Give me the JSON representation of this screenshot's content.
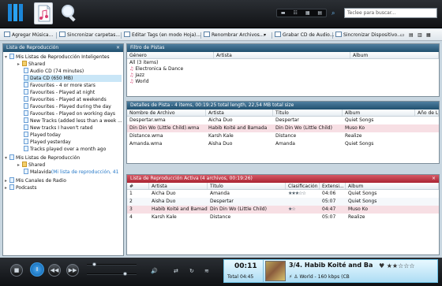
{
  "search": {
    "placeholder": "Teclee para buscar..."
  },
  "toolbar": {
    "items": [
      "Agregar Música...",
      "Sincronizar carpetas...",
      "Editar Tags (en modo Hoja)...",
      "Renombrar Archivos...",
      "Grabar CD de Audio...",
      "Sincronizar Dispositivo..."
    ]
  },
  "left_panel": {
    "title": "Lista de Reproducción",
    "items": [
      "Mis Listas de Reproducción Inteligentes",
      "Shared",
      "Audio CD (74 minutes)",
      "Data CD (650 MB)",
      "Favourites - 4 or more stars",
      "Favourites - Played at night",
      "Favourites - Played at weekends",
      "Favourites - Played during the day",
      "Favourites - Played on working days",
      "New Tracks (added less than a week ...",
      "New tracks I haven't rated",
      "Played today",
      "Played yesterday",
      "Tracks played over a month ago",
      "Mis Listas de Reproducción",
      "Shared",
      "Malavida",
      "(Mi lista de reproducción, 41",
      "Mis Canales de Radio",
      "Podcasts"
    ]
  },
  "filter": {
    "title": "Filtro de Pistas",
    "headers": [
      "Género",
      "Artista",
      "Album"
    ],
    "rows": [
      "All (3 items)",
      "Electronica & Dance",
      "Jazz",
      "World"
    ]
  },
  "details": {
    "title": "Detalles de Pista - 4 items, 00:19:25 total length, 22,54 MB total size",
    "headers": [
      "Nombre de Archivo",
      "Artista",
      "Título",
      "Album",
      "Año de La"
    ],
    "rows": [
      [
        "Despertar.wma",
        "Aicha Duo",
        "Despertar",
        "Quiet Songs",
        ""
      ],
      [
        "Din Din Wo (Little Child).wma",
        "Habib Koité and Bamada",
        "Din Din Wo (Little Child)",
        "Muso Ko",
        ""
      ],
      [
        "Distance.wma",
        "Karsh Kale",
        "Distance",
        "Realize",
        ""
      ],
      [
        "Amanda.wma",
        "Aisha Duo",
        "Amanda",
        "Quiet Songs",
        ""
      ]
    ]
  },
  "active": {
    "title": "Lista de Reproducción Activa (4 archivos, 00:19:26)",
    "headers": [
      "#",
      "Artista",
      "Título",
      "Clasificación",
      "Extensi...",
      "Album"
    ],
    "rows": [
      [
        "1",
        "Aicha Duo",
        "Amanda",
        "★★★☆☆",
        "04:06",
        "Quiet Songs"
      ],
      [
        "2",
        "Aisha Duo",
        "Despertar",
        "",
        "05:07",
        "Quiet Songs"
      ],
      [
        "3",
        "Habib Koité and Bamada",
        "Din Din Wo (Little Child)",
        "★☆",
        "04:47",
        "Muso Ko"
      ],
      [
        "4",
        "Karsh Kale",
        "Distance",
        "",
        "05:07",
        "Realize"
      ]
    ]
  },
  "player": {
    "time": "00:11",
    "total_label": "Total",
    "total_time": "04:45",
    "track": "3/4. Habib Koité and Ba",
    "meta": "World - 160 kbps (CB"
  },
  "colors": {
    "accent": "#20506f",
    "active_playlist": "#aa2432",
    "player_cyan": "#aeddf4"
  }
}
